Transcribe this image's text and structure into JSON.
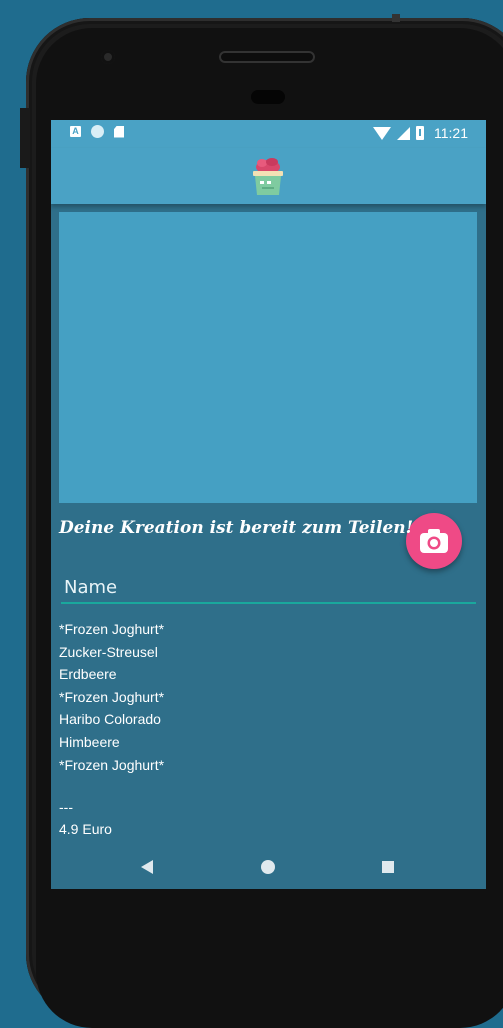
{
  "status_bar": {
    "time": "11:21",
    "left_icons": [
      "keyboard-a-icon",
      "circle-icon",
      "sd-card-icon"
    ],
    "right_icons": [
      "wifi-icon",
      "signal-icon",
      "battery-icon"
    ],
    "a_glyph": "A"
  },
  "app_bar": {
    "logo": "frozen-yogurt-cup-logo"
  },
  "photo": {
    "camera_button_icon": "camera-icon"
  },
  "content": {
    "headline": "Deine Kreation ist bereit zum Teilen!",
    "name_placeholder": "Name",
    "ingredients": [
      "*Frozen Joghurt*",
      "Zucker-Streusel",
      "Erdbeere",
      "*Frozen Joghurt*",
      "Haribo Colorado",
      "Himbeere",
      "*Frozen Joghurt*"
    ],
    "separator": "---",
    "price": "4.9 Euro"
  },
  "nav_bar": {
    "buttons": [
      "back-icon",
      "home-icon",
      "recents-icon"
    ]
  },
  "colors": {
    "background": "#1f6c8e",
    "app_bar": "#4aa2c5",
    "screen": "#2f6f8a",
    "photo_area": "#45a0c3",
    "fab": "#ef4a86",
    "input_underline": "#1aa89d"
  }
}
